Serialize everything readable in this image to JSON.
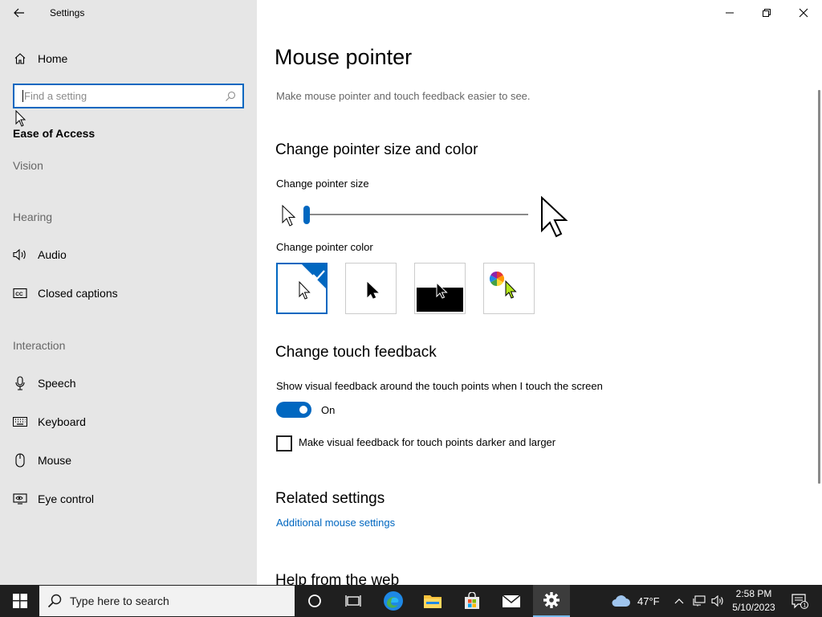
{
  "window": {
    "title": "Settings"
  },
  "sidebar": {
    "home_label": "Home",
    "search_placeholder": "Find a setting",
    "category_title": "Ease of Access",
    "sections": [
      {
        "heading": "Vision"
      },
      {
        "heading": "Hearing",
        "items": [
          {
            "label": "Audio",
            "icon": "speaker-icon"
          },
          {
            "label": "Closed captions",
            "icon": "closed-captions-icon"
          }
        ]
      },
      {
        "heading": "Interaction",
        "items": [
          {
            "label": "Speech",
            "icon": "microphone-icon"
          },
          {
            "label": "Keyboard",
            "icon": "keyboard-icon"
          },
          {
            "label": "Mouse",
            "icon": "mouse-icon"
          },
          {
            "label": "Eye control",
            "icon": "eye-control-icon"
          }
        ]
      }
    ]
  },
  "main": {
    "title": "Mouse pointer",
    "description": "Make mouse pointer and touch feedback easier to see.",
    "pointer_section": {
      "heading": "Change pointer size and color",
      "size_label": "Change pointer size",
      "size_value": 1,
      "size_min": 1,
      "size_max": 15,
      "color_label": "Change pointer color",
      "color_options": [
        {
          "name": "white",
          "selected": true
        },
        {
          "name": "black",
          "selected": false
        },
        {
          "name": "inverted",
          "selected": false
        },
        {
          "name": "custom",
          "selected": false
        }
      ],
      "accent_color": "#0067c0"
    },
    "touch_section": {
      "heading": "Change touch feedback",
      "toggle_label": "Show visual feedback around the touch points when I touch the screen",
      "toggle_state": "On",
      "checkbox_label": "Make visual feedback for touch points darker and larger",
      "checkbox_checked": false
    },
    "related": {
      "heading": "Related settings",
      "link": "Additional mouse settings"
    },
    "help_heading": "Help from the web"
  },
  "taskbar": {
    "search_placeholder": "Type here to search",
    "weather_temp": "47°F",
    "time": "2:58 PM",
    "date": "5/10/2023",
    "notification_count": "1"
  }
}
